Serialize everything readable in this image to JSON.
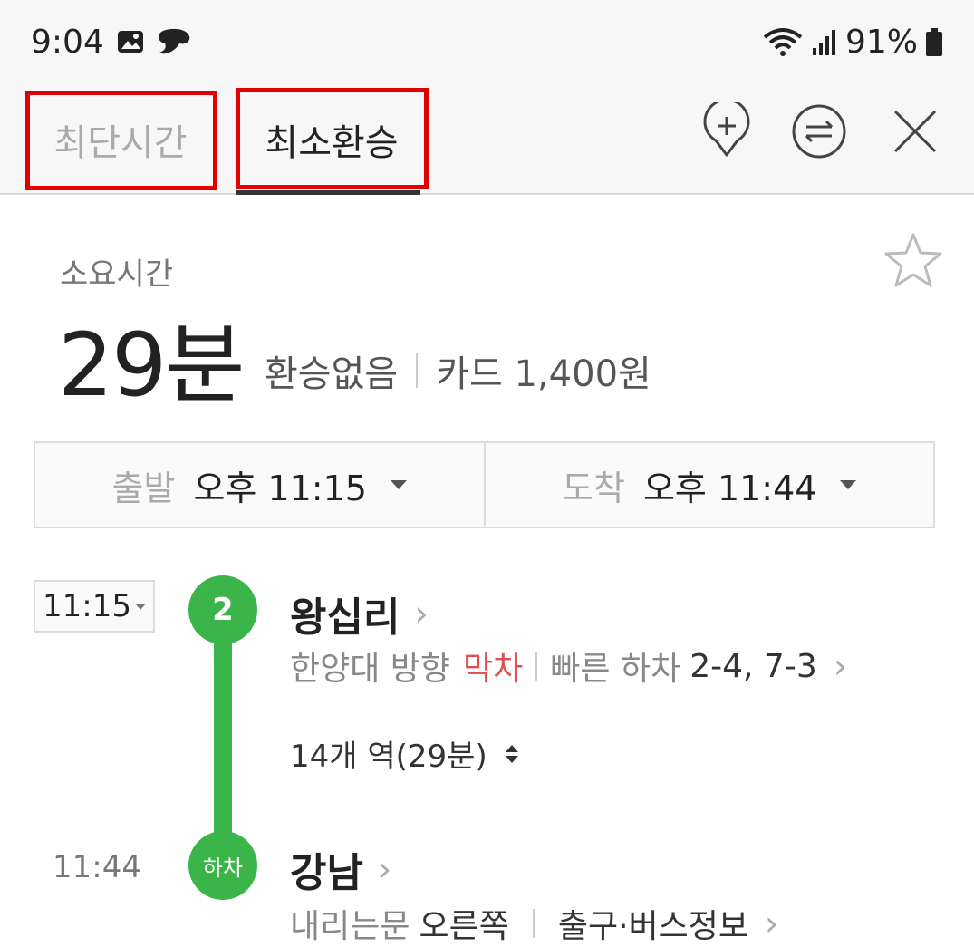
{
  "status_bar": {
    "time": "9:04",
    "battery": "91%",
    "left_icons": [
      "gallery-icon",
      "chat-icon"
    ],
    "right_icons": [
      "wifi-icon",
      "signal-icon",
      "battery-icon"
    ]
  },
  "tabs": [
    {
      "label": "최단시간",
      "active": false
    },
    {
      "label": "최소환승",
      "active": true
    }
  ],
  "header_icons": [
    "add-place-icon",
    "swap-icon",
    "close-icon"
  ],
  "summary": {
    "duration_label": "소요시간",
    "duration": "29분",
    "transfer": "환승없음",
    "fare": "카드 1,400원"
  },
  "time_selector": {
    "depart_label": "출발",
    "depart_time": "오후 11:15",
    "arrive_label": "도착",
    "arrive_time": "오후 11:44"
  },
  "route": {
    "line_badge": "2",
    "line_color": "#3bb54a",
    "board": {
      "time": "11:15",
      "station": "왕십리",
      "direction": "한양대 방향",
      "last_train": "막차",
      "fast_exit_label": "빠른 하차",
      "fast_exit_value": "2-4, 7-3"
    },
    "stops_summary": "14개 역(29분)",
    "alight": {
      "badge": "하차",
      "time": "11:44",
      "station": "강남",
      "door_label": "내리는문",
      "door_side": "오른쪽",
      "exit_info": "출구·버스정보"
    }
  },
  "colors": {
    "highlight_box": "#e10000",
    "accent_red": "#e05050",
    "line_green": "#3bb54a"
  }
}
